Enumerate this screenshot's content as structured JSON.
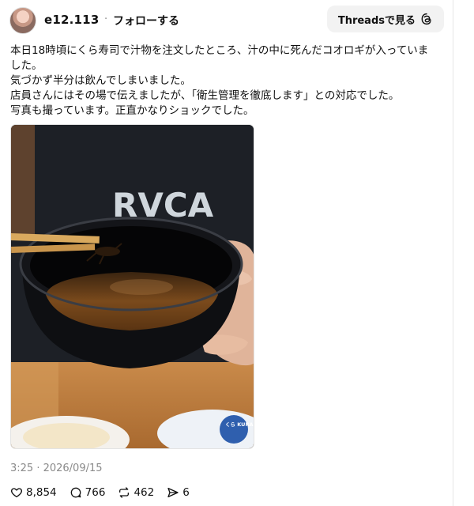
{
  "header": {
    "username": "e12.113",
    "separator": "·",
    "follow_label": "フォローする",
    "open_in_threads_label": "Threadsで見る"
  },
  "post": {
    "lines": [
      "本日18時頃にくら寿司で汁物を注文したところ、汁の中に死んだコオロギが入っていま",
      "した。",
      "気づかず半分は飲んでしまいました。",
      "店員さんにはその場で伝えましたが、「衛生管理を徹底します」との対応でした。",
      "写真も撮っています。正直かなりショックでした。"
    ],
    "photo_text": {
      "shirt_print": "RVCA",
      "plate_logo": "くら KURA"
    },
    "timestamp": "3:25 · 2026/09/15"
  },
  "stats": {
    "likes": "8,854",
    "replies": "766",
    "reposts": "462",
    "shares": "6"
  },
  "icons": {
    "like": "heart-icon",
    "reply": "comment-bubble-icon",
    "repost": "repost-arrows-icon",
    "share": "share-send-icon",
    "threads": "threads-logo-icon"
  },
  "colors": {
    "text": "#111111",
    "muted": "#8a8a8a",
    "button_bg": "#f2f2f2",
    "soup": "#6b3f18"
  }
}
